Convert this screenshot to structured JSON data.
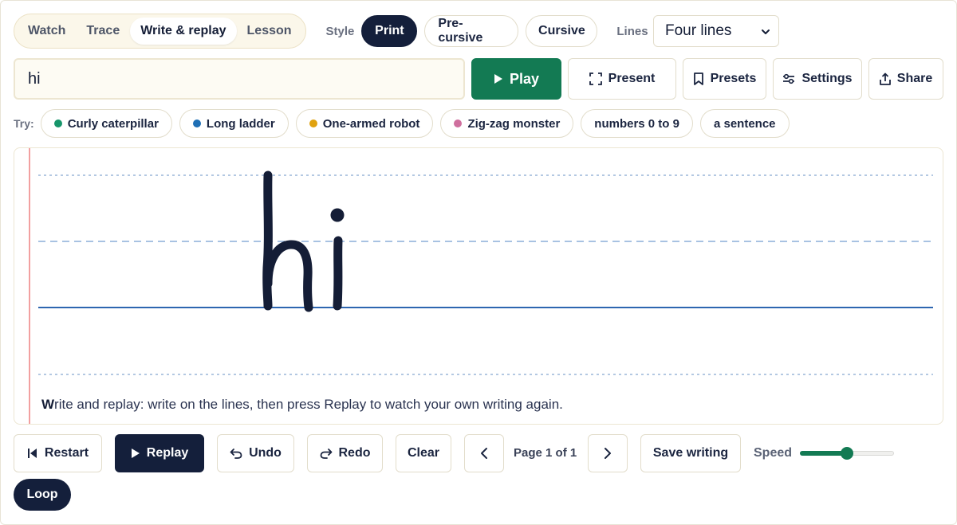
{
  "modes": [
    "Watch",
    "Trace",
    "Write & replay",
    "Lesson"
  ],
  "active_mode": "Write & replay",
  "style": {
    "label": "Style",
    "options": [
      "Print",
      "Pre-cursive",
      "Cursive"
    ],
    "selected": "Print"
  },
  "lines": {
    "label": "Lines",
    "selected": "Four lines"
  },
  "text_input": {
    "value": "hi"
  },
  "toolbar": {
    "play": "Play",
    "present": "Present",
    "presets": "Presets",
    "settings": "Settings",
    "share": "Share"
  },
  "try": {
    "label": "Try:",
    "chips": [
      {
        "label": "Curly caterpillar",
        "dot_color": "#16956a"
      },
      {
        "label": "Long ladder",
        "dot_color": "#1f6fb5"
      },
      {
        "label": "One-armed robot",
        "dot_color": "#e0a20f"
      },
      {
        "label": "Zig-zag monster",
        "dot_color": "#cf6f9e"
      },
      {
        "label": "numbers 0 to 9"
      },
      {
        "label": "a sentence"
      }
    ]
  },
  "canvas": {
    "written_text": "hi",
    "hint_lead": "W",
    "hint": "rite and replay: write on the lines, then press Replay to watch your own writing again."
  },
  "controls": {
    "restart": "Restart",
    "replay": "Replay",
    "undo": "Undo",
    "redo": "Redo",
    "clear": "Clear",
    "page": "Page 1 of 1",
    "save": "Save writing",
    "speed_label": "Speed",
    "speed_value": 0.5,
    "loop": "Loop"
  },
  "colors": {
    "accent_green": "#137a53",
    "dark_navy": "#141f3b",
    "guide_blue": "#2e66b0",
    "margin_red": "#f08a8a"
  }
}
